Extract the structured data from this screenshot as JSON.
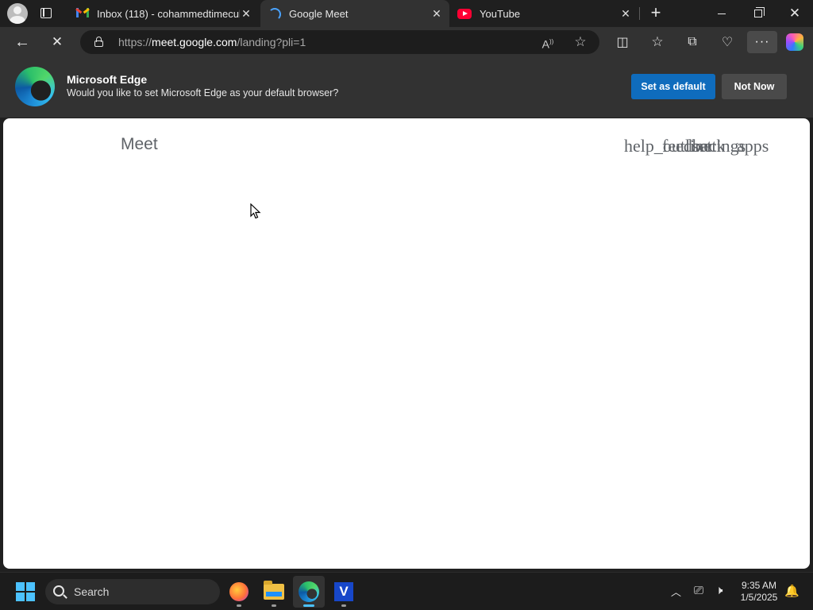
{
  "tabs": [
    {
      "title": "Inbox (118) - cohammedtimecube",
      "favicon": "gmail-icon",
      "active": false
    },
    {
      "title": "Google Meet",
      "favicon": "loading-spinner-icon",
      "active": true
    },
    {
      "title": "YouTube",
      "favicon": "youtube-icon",
      "active": false
    }
  ],
  "address_bar": {
    "url_scheme": "https://",
    "url_host": "meet.google.com",
    "url_path": "/landing?pli=1"
  },
  "infobar": {
    "title": "Microsoft Edge",
    "message": "Would you like to set Microsoft Edge as your default browser?",
    "primary_button": "Set as default",
    "secondary_button": "Not Now"
  },
  "page": {
    "app_title": "Meet",
    "icon_ligatures": [
      "help_outline",
      "feedback",
      "settings",
      "apps"
    ]
  },
  "taskbar": {
    "search_label": "Search",
    "time": "9:35 AM",
    "date": "1/5/2025",
    "apps": [
      "firefox-icon",
      "file-explorer-icon",
      "edge-icon",
      "vnc-viewer-icon"
    ]
  },
  "colors": {
    "accent_blue": "#0f6cbd",
    "page_background": "#ffffff",
    "chrome_dark": "#323232",
    "meet_text_gray": "#5f6368"
  }
}
